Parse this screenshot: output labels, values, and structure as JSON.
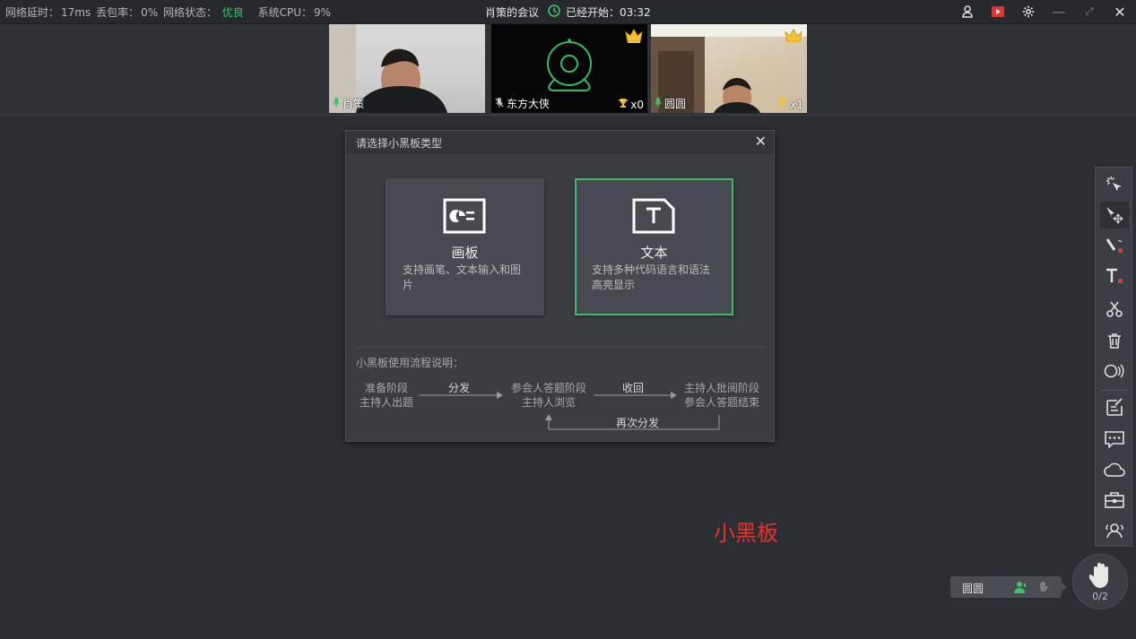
{
  "status_bar": {
    "latency_label": "网络延时：",
    "latency_value": "17ms",
    "loss_label": "丢包率：",
    "loss_value": "0%",
    "net_label": "网络状态：",
    "net_value": "优良",
    "cpu_label": "系统CPU：",
    "cpu_value": "9%"
  },
  "meeting": {
    "title": "肖策的会议",
    "elapsed_label": "已经开始：",
    "elapsed_value": "03:32"
  },
  "participants": [
    {
      "name": "肖策",
      "mic": "on"
    },
    {
      "name": "东方大侠",
      "mic": "off",
      "trophy": "x0",
      "crown": true
    },
    {
      "name": "圆圆",
      "mic": "on",
      "trophy": "x1",
      "crown": true
    }
  ],
  "dialog": {
    "title": "请选择小黑板类型",
    "close": "✕",
    "cards": [
      {
        "title": "画板",
        "desc": "支持画笔、文本输入和图片",
        "icon": "drawing-board-icon"
      },
      {
        "title": "文本",
        "desc": "支持多种代码语言和语法高亮显示",
        "icon": "text-document-icon",
        "selected": true
      }
    ],
    "flow_title": "小黑板使用流程说明：",
    "flow": {
      "step1_line1": "准备阶段",
      "step1_line2": "主持人出题",
      "arrow1": "分发",
      "step2_line1": "参会人答题阶段",
      "step2_line2": "主持人浏览",
      "arrow2": "收回",
      "step3_line1": "主持人批阅阶段",
      "step3_line2": "参会人答题结束",
      "loop": "再次分发"
    }
  },
  "toolbar": {
    "tools": [
      "laser-pointer-icon",
      "select-move-icon",
      "pen-icon",
      "text-tool-icon",
      "scissors-icon",
      "trash-icon",
      "eraser-icon",
      "edit-note-icon",
      "chat-icon",
      "cloud-icon",
      "toolbox-icon",
      "members-icon"
    ]
  },
  "caption": "小黑板",
  "raise_hand": {
    "name": "圆圆",
    "count": "0/2"
  },
  "colors": {
    "accent": "#3dbb6a",
    "caption": "#e8342a",
    "background": "#2b2e33"
  }
}
